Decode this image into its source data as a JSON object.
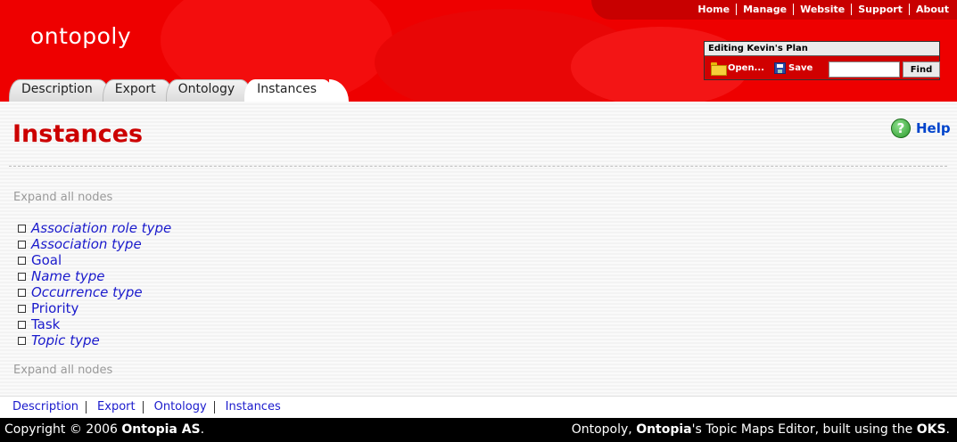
{
  "header": {
    "logo": "ontopoly",
    "top_nav": [
      "Home",
      "Manage",
      "Website",
      "Support",
      "About"
    ]
  },
  "edit_box": {
    "title": "Editing Kevin's Plan",
    "open_label": "Open...",
    "save_label": "Save",
    "search_value": "",
    "find_label": "Find"
  },
  "tabs": [
    {
      "label": "Description",
      "active": false
    },
    {
      "label": "Export",
      "active": false
    },
    {
      "label": "Ontology",
      "active": false
    },
    {
      "label": "Instances",
      "active": true
    }
  ],
  "main": {
    "title": "Instances",
    "help_label": "Help",
    "expand_label": "Expand all nodes",
    "tree": [
      {
        "label": "Association role type",
        "italic": true
      },
      {
        "label": "Association type",
        "italic": true
      },
      {
        "label": "Goal",
        "italic": false
      },
      {
        "label": "Name type",
        "italic": true
      },
      {
        "label": "Occurrence type",
        "italic": true
      },
      {
        "label": "Priority",
        "italic": false
      },
      {
        "label": "Task",
        "italic": false
      },
      {
        "label": "Topic type",
        "italic": true
      }
    ]
  },
  "bottom_nav": [
    "Description",
    "Export",
    "Ontology",
    "Instances"
  ],
  "footer": {
    "copyright": "Copyright © 2006 ",
    "company": "Ontopia AS",
    "copyright_end": ".",
    "credits_a": "Ontopoly, ",
    "credits_b": "Ontopia",
    "credits_c": "'s Topic Maps Editor, built using the ",
    "credits_d": "OKS",
    "credits_e": "."
  },
  "colors": {
    "brand_red": "#ee0000",
    "title_red": "#cc0000",
    "link_blue": "#1a1acc"
  }
}
